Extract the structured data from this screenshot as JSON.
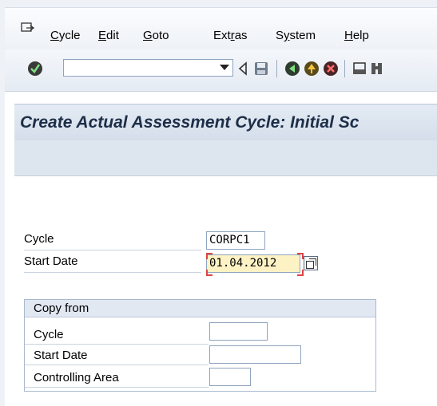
{
  "menu": {
    "items": [
      {
        "label": "Cycle",
        "key": "C"
      },
      {
        "label": "Edit",
        "key": "E"
      },
      {
        "label": "Goto",
        "key": "G"
      },
      {
        "label": "Extras",
        "key": "r"
      },
      {
        "label": "System",
        "key": "y"
      },
      {
        "label": "Help",
        "key": "H"
      }
    ]
  },
  "toolbar": {
    "command_field_value": "",
    "icons": [
      "enter-check-icon",
      "back-triangle-icon",
      "save-icon",
      "back-icon",
      "exit-icon",
      "cancel-icon",
      "print-icon",
      "find-icon"
    ]
  },
  "title": "Create Actual Assessment Cycle: Initial Sc",
  "form": {
    "cycle_label": "Cycle",
    "cycle_value": "CORPC1",
    "start_date_label": "Start Date",
    "start_date_value": "01.04.2012"
  },
  "copy_from": {
    "title": "Copy from",
    "cycle_label": "Cycle",
    "cycle_value": "",
    "start_date_label": "Start Date",
    "start_date_value": "",
    "controlling_area_label": "Controlling Area",
    "controlling_area_value": ""
  },
  "colors": {
    "title_text": "#1d2e48",
    "required_field_bg": "#fdf2c4",
    "frame": "#eef2f7"
  }
}
